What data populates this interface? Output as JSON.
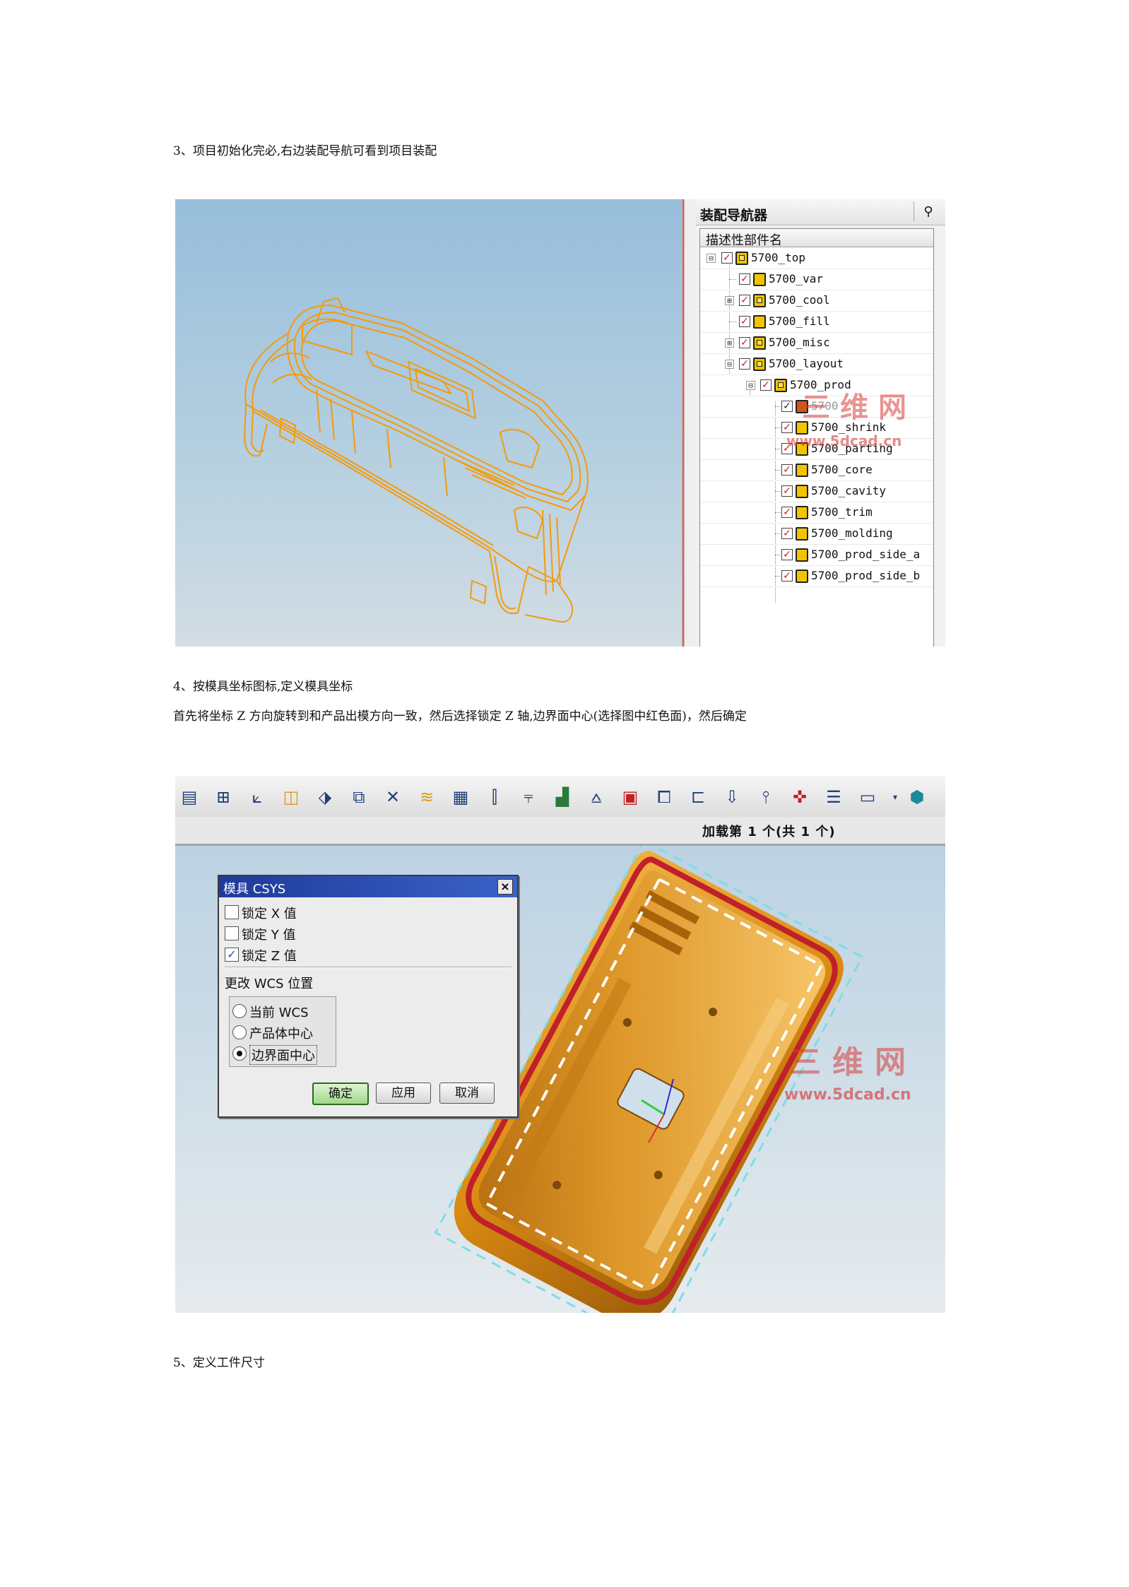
{
  "paragraphs": {
    "p3": "3、项目初始化完必,右边装配导航可看到项目装配",
    "p4a": "4、按模具坐标图标,定义模具坐标",
    "p4b": "首先将坐标 Z 方向旋转到和产品出模方向一致，然后选择锁定 Z 轴,边界面中心(选择图中红色面)，然后确定",
    "p5": "5、定义工件尺寸"
  },
  "figure1": {
    "navigator_title": "装配导航器",
    "pin_icon": "pin-icon",
    "column_header": "描述性部件名",
    "tree": [
      {
        "label": "5700_top",
        "expander": "⊟",
        "checked": true,
        "icon": "assembly-icon"
      },
      {
        "label": "5700_var",
        "expander": "",
        "checked": true,
        "icon": "part-icon"
      },
      {
        "label": "5700_cool",
        "expander": "⊞",
        "checked": true,
        "icon": "assembly-icon"
      },
      {
        "label": "5700_fill",
        "expander": "",
        "checked": true,
        "icon": "part-icon"
      },
      {
        "label": "5700_misc",
        "expander": "⊞",
        "checked": true,
        "icon": "assembly-icon"
      },
      {
        "label": "5700_layout",
        "expander": "⊟",
        "checked": true,
        "icon": "assembly-icon"
      },
      {
        "label": "5700_prod",
        "expander": "⊟",
        "checked": true,
        "icon": "assembly-icon"
      },
      {
        "label": "5700",
        "expander": "",
        "checked": false,
        "icon": "part-icon"
      },
      {
        "label": "5700_shrink",
        "expander": "",
        "checked": true,
        "icon": "part-icon"
      },
      {
        "label": "5700_parting",
        "expander": "",
        "checked": true,
        "icon": "part-icon"
      },
      {
        "label": "5700_core",
        "expander": "",
        "checked": true,
        "icon": "part-icon"
      },
      {
        "label": "5700_cavity",
        "expander": "",
        "checked": true,
        "icon": "part-icon"
      },
      {
        "label": "5700_trim",
        "expander": "",
        "checked": true,
        "icon": "part-icon"
      },
      {
        "label": "5700_molding",
        "expander": "",
        "checked": true,
        "icon": "part-icon"
      },
      {
        "label": "5700_prod_side_a",
        "expander": "",
        "checked": true,
        "icon": "part-icon"
      },
      {
        "label": "5700_prod_side_b",
        "expander": "",
        "checked": true,
        "icon": "part-icon"
      }
    ],
    "watermark_brand": "三维网",
    "watermark_url": "www.5dcad.cn",
    "wireframe_color": "#f59a0a"
  },
  "figure2": {
    "toolbar_icons": [
      "new-part-icon",
      "assembly-grid-icon",
      "mold-csys-icon",
      "shrinkage-icon",
      "workpiece-icon",
      "layout-icon",
      "mold-tools-icon",
      "runner-icon",
      "parting-icon",
      "slider-icon",
      "ejector-icon",
      "cooling-icon",
      "electrode-icon",
      "sub-insert-icon",
      "mold-base-icon",
      "standard-part-icon",
      "gate-icon",
      "pocket-icon",
      "cavity-icon",
      "bill-of-materials-icon",
      "drawing-icon",
      "view-manager-icon",
      "dropdown-arrow-icon",
      "globe-icon"
    ],
    "status_text": "加载第 1 个(共 1 个)",
    "dialog": {
      "title": "模具 CSYS",
      "close_icon": "close-icon",
      "lock_x": "锁定 X 值",
      "lock_y": "锁定 Y 值",
      "lock_z": "锁定 Z 值",
      "lock_x_checked": false,
      "lock_y_checked": false,
      "lock_z_checked": true,
      "wcs_section": "更改 WCS 位置",
      "options": [
        "当前 WCS",
        "产品体中心",
        "边界面中心"
      ],
      "selected_option": "边界面中心",
      "ok": "确定",
      "apply": "应用",
      "cancel": "取消"
    },
    "watermark_brand": "三维网",
    "watermark_url": "www.5dcad.cn",
    "part_color": "#d98a12",
    "highlight_face_color": "#c0202a"
  }
}
